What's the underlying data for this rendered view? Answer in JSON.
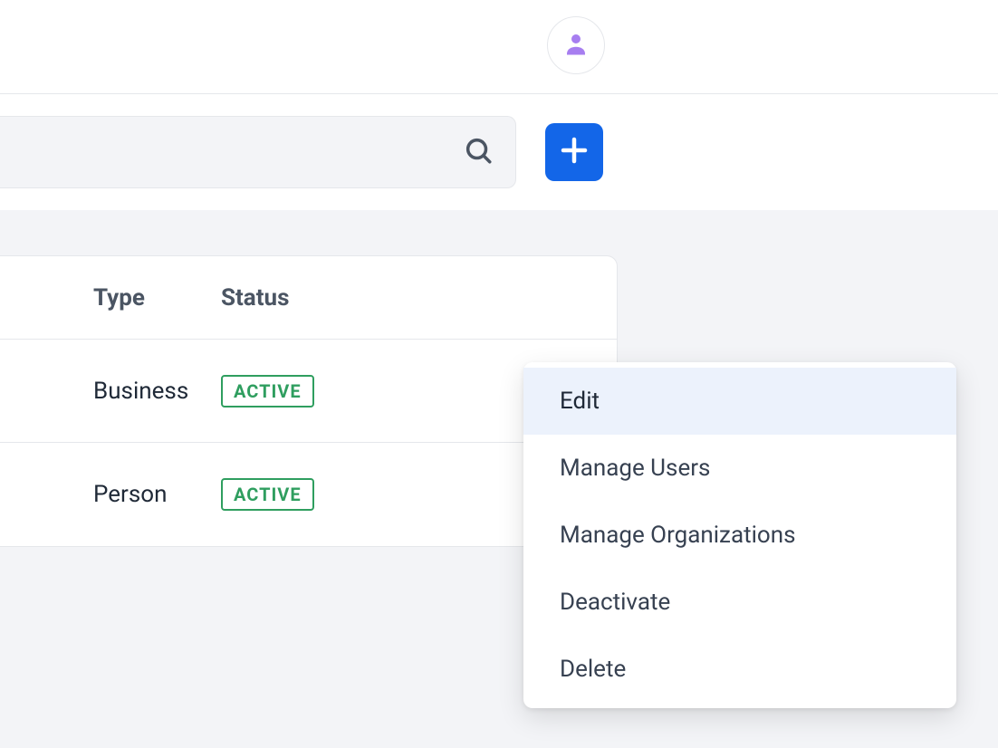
{
  "header": {
    "avatar_icon": "person-icon"
  },
  "toolbar": {
    "search_placeholder": "",
    "add_button": "+"
  },
  "table": {
    "columns": {
      "type": "Type",
      "status": "Status"
    },
    "rows": [
      {
        "type": "Business",
        "status": "ACTIVE"
      },
      {
        "type": "Person",
        "status": "ACTIVE"
      }
    ]
  },
  "dropdown": {
    "items": [
      "Edit",
      "Manage Users",
      "Manage Organizations",
      "Deactivate",
      "Delete"
    ],
    "highlighted_index": 0
  },
  "colors": {
    "accent_blue": "#1366e8",
    "avatar_purple": "#a77ef0",
    "status_green": "#2f9e5f",
    "grey_bg": "#f3f4f7"
  }
}
